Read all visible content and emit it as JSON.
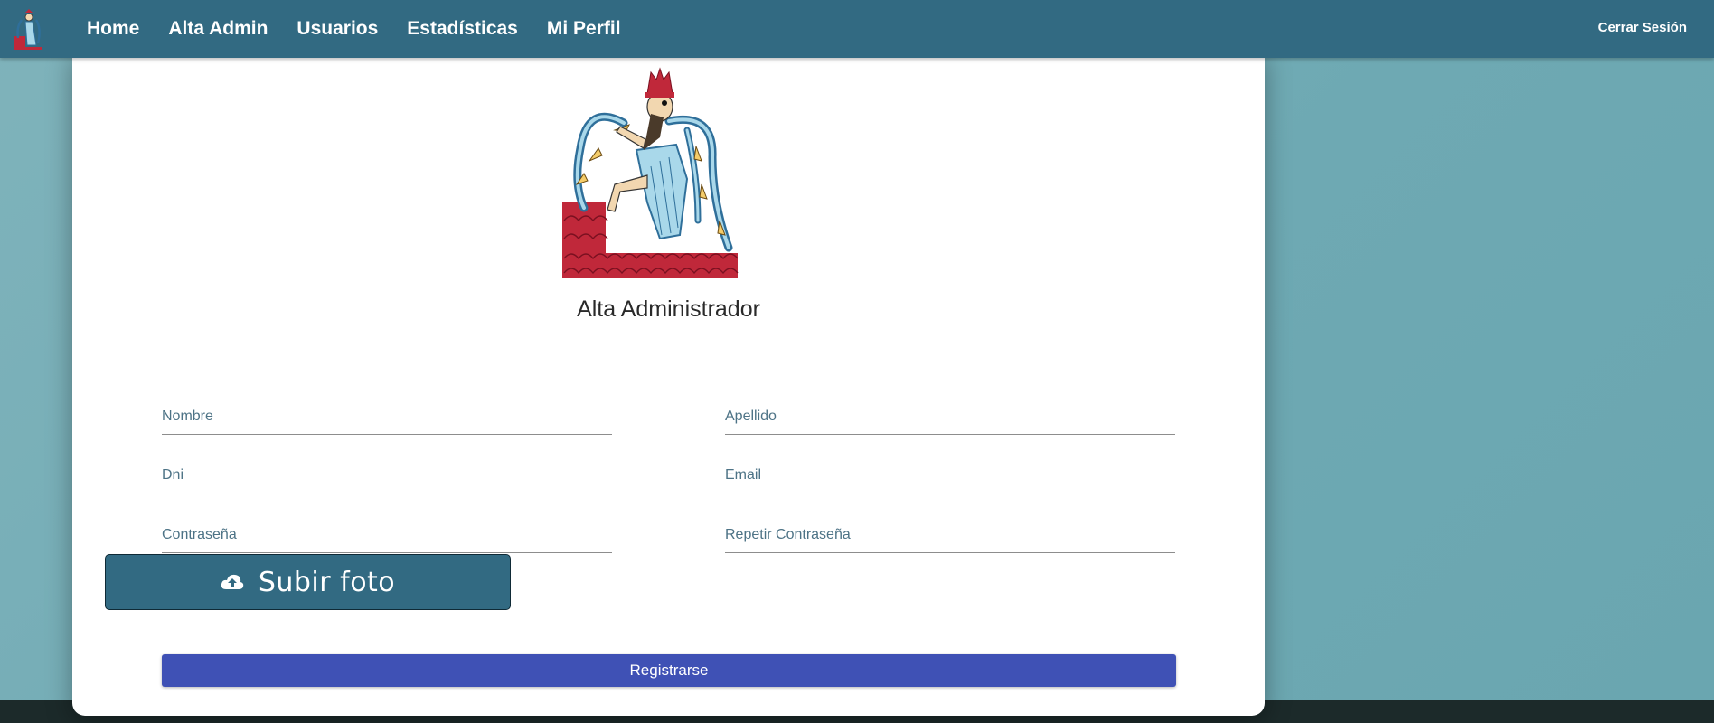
{
  "nav": {
    "items": [
      {
        "label": "Home"
      },
      {
        "label": "Alta Admin"
      },
      {
        "label": "Usuarios"
      },
      {
        "label": "Estadísticas"
      },
      {
        "label": "Mi Perfil"
      }
    ],
    "logout_label": "Cerrar Sesión"
  },
  "form": {
    "title": "Alta Administrador",
    "fields": {
      "nombre": {
        "placeholder": "Nombre",
        "value": ""
      },
      "apellido": {
        "placeholder": "Apellido",
        "value": ""
      },
      "dni": {
        "placeholder": "Dni",
        "value": ""
      },
      "email": {
        "placeholder": "Email",
        "value": ""
      },
      "password": {
        "placeholder": "Contraseña",
        "value": ""
      },
      "password_repeat": {
        "placeholder": "Repetir Contraseña",
        "value": ""
      }
    },
    "upload_label": "Subir foto",
    "submit_label": "Registrarse"
  },
  "colors": {
    "navbar": "#326a82",
    "background": "#72adb6",
    "upload_button": "#326a82",
    "submit_button": "#3f51b5",
    "logo_red": "#c0283a",
    "logo_blue": "#2f6f9a"
  },
  "icons": {
    "logo": "deity-figure-logo-icon",
    "upload": "cloud-upload-icon"
  }
}
